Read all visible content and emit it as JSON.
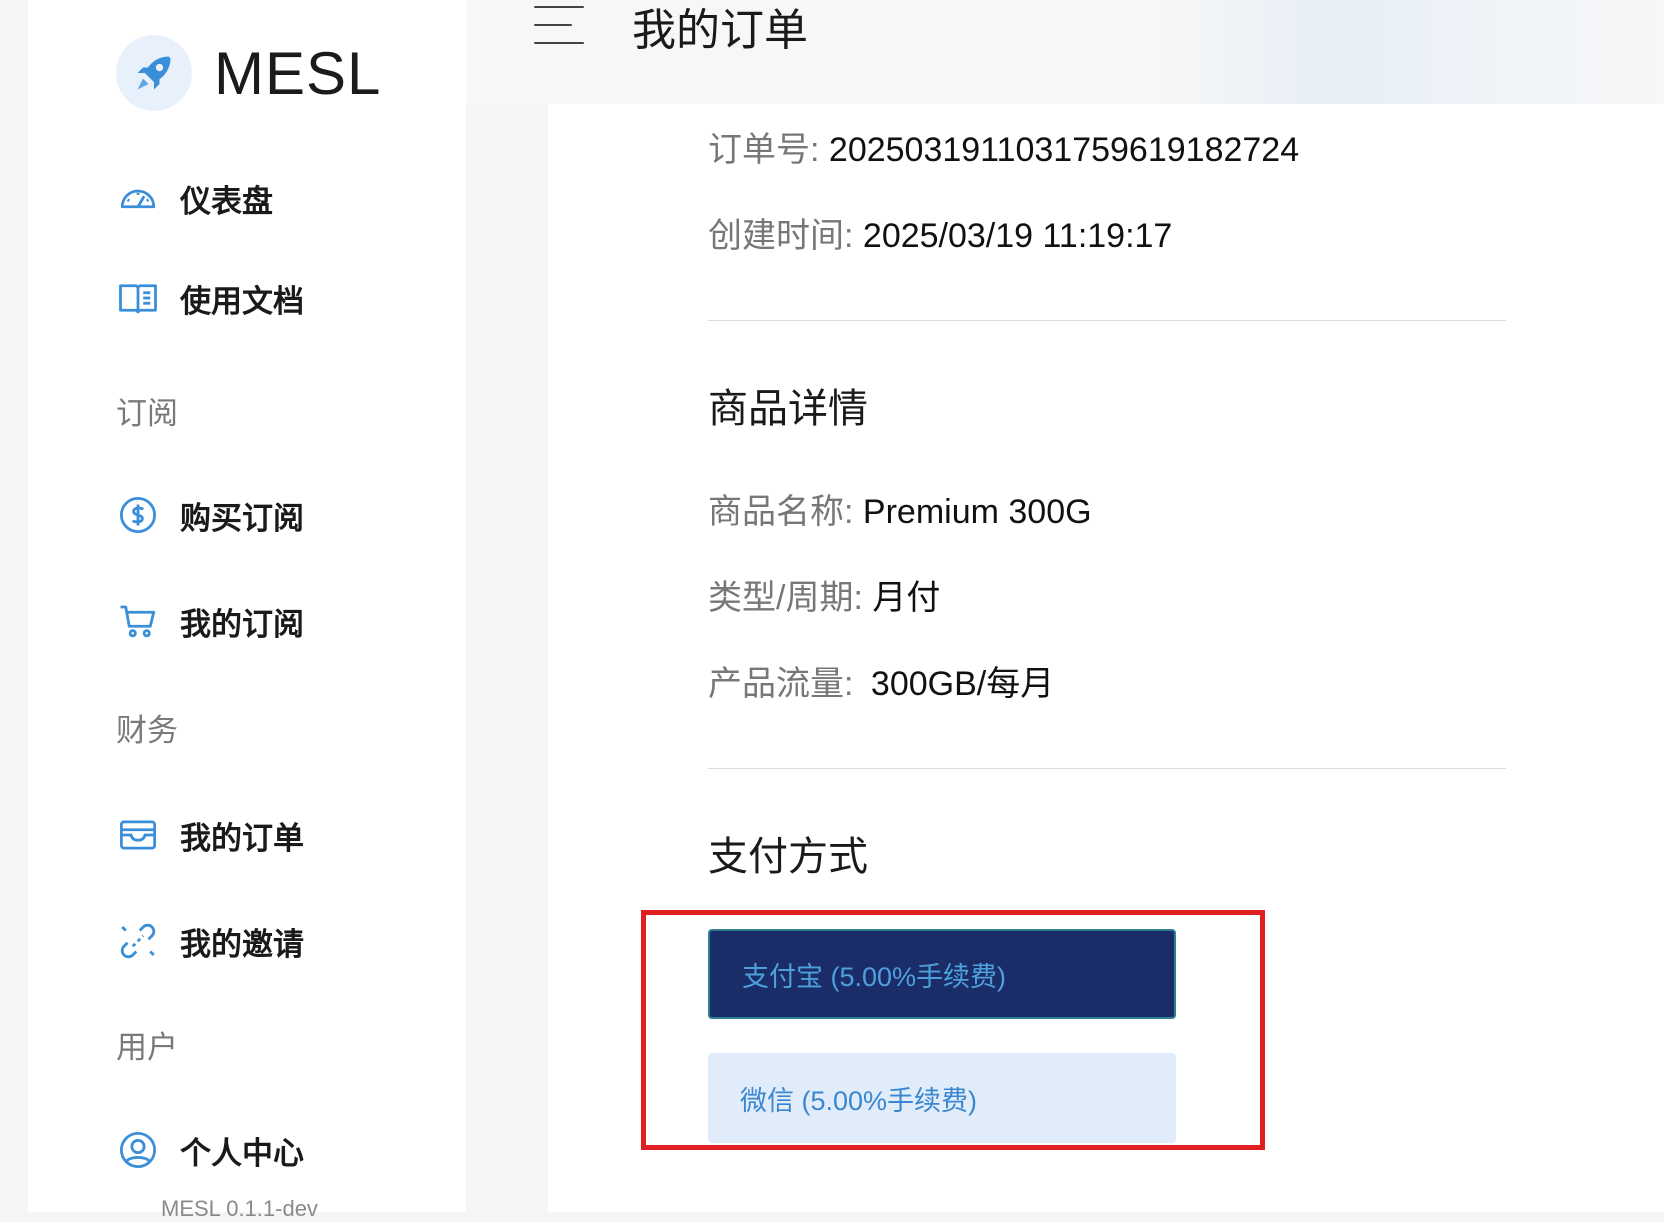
{
  "brand": {
    "name": "MESL",
    "logo": "rocket-icon"
  },
  "sidebar": {
    "items": [
      {
        "label": "仪表盘",
        "icon": "dashboard-gauge-icon"
      },
      {
        "label": "使用文档",
        "icon": "book-icon"
      }
    ],
    "groups": [
      {
        "title": "订阅",
        "items": [
          {
            "label": "购买订阅",
            "icon": "dollar-circle-icon"
          },
          {
            "label": "我的订阅",
            "icon": "cart-icon"
          }
        ]
      },
      {
        "title": "财务",
        "items": [
          {
            "label": "我的订单",
            "icon": "wallet-icon"
          },
          {
            "label": "我的邀请",
            "icon": "link-icon"
          }
        ]
      },
      {
        "title": "用户",
        "items": [
          {
            "label": "个人中心",
            "icon": "user-circle-icon"
          }
        ]
      }
    ],
    "version": "MESL 0.1.1-dev"
  },
  "header": {
    "title": "我的订单",
    "menu_icon": "menu-lines-icon"
  },
  "order": {
    "number_label": "订单号:",
    "number_value": "2025031911031759619182724",
    "created_label": "创建时间:",
    "created_value": "2025/03/19 11:19:17"
  },
  "product": {
    "section_title": "商品详情",
    "name_label": "商品名称:",
    "name_value": "Premium 300G",
    "type_label": "类型/周期:",
    "type_value": "月付",
    "traffic_label": "产品流量:",
    "traffic_value": "300GB/每月"
  },
  "payment": {
    "section_title": "支付方式",
    "methods": [
      {
        "label": "支付宝 (5.00%手续费)",
        "selected": true
      },
      {
        "label": "微信 (5.00%手续费)",
        "selected": false
      }
    ]
  },
  "colors": {
    "selected_bg": "#1a2d68",
    "selected_text": "#4ea0dc",
    "unselected_bg": "#e1ecfa",
    "highlight_border": "#e02020",
    "icon_blue": "#3b8fd9"
  }
}
